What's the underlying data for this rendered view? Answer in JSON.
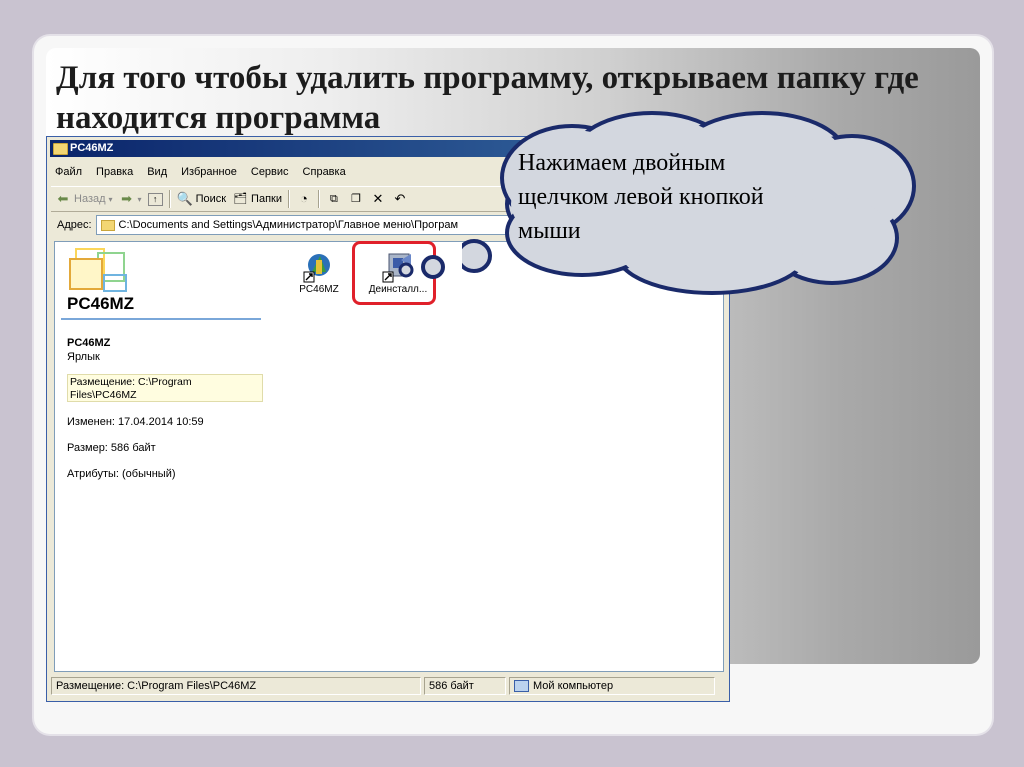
{
  "slide": {
    "title_line1": "Для того чтобы удалить программу, открываем папку где",
    "title_line2": "находится программа",
    "callout_line1": "Нажимаем двойным",
    "callout_line2": "щелчком левой кнопкой",
    "callout_line3": "мыши"
  },
  "window": {
    "title": "PC46MZ",
    "menu": [
      "Файл",
      "Правка",
      "Вид",
      "Избранное",
      "Сервис",
      "Справка"
    ],
    "toolbar": {
      "back_label": "Назад",
      "search_label": "Поиск",
      "folders_label": "Папки"
    },
    "address": {
      "label": "Адрес:",
      "value": "C:\\Documents and Settings\\Администратор\\Главное меню\\Програм"
    }
  },
  "details_pane": {
    "heading": "PC46MZ",
    "name": "PC46MZ",
    "kind": "Ярлык",
    "location": "Размещение: C:\\Program Files\\PC46MZ",
    "location_line1": "Размещение: C:\\Program",
    "location_line2": "Files\\PC46MZ",
    "modified": "Изменен: 17.04.2014 10:59",
    "size": "Размер: 586 байт",
    "attributes": "Атрибуты: (обычный)"
  },
  "files": [
    {
      "label": "PC46MZ",
      "icon": "app-shortcut-icon"
    },
    {
      "label": "Деинсталл...",
      "icon": "uninstall-shortcut-icon"
    }
  ],
  "statusbar": {
    "location": "Размещение: C:\\Program Files\\PC46MZ",
    "size": "586 байт",
    "zone": "Мой компьютер"
  },
  "colors": {
    "highlight": "#e0202a",
    "titlebar_start": "#0a246a",
    "callout_border": "#1a2a6a",
    "callout_fill": "#d3d7df"
  }
}
